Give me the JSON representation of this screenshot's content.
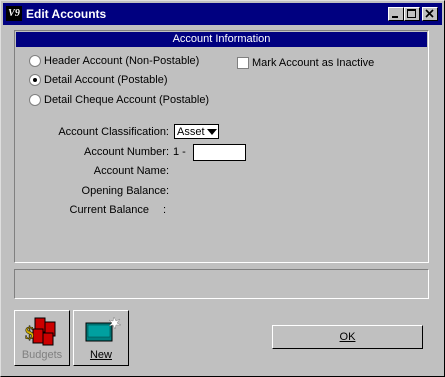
{
  "window": {
    "title": "Edit Accounts",
    "icon_text": "V9"
  },
  "panel": {
    "header": "Account Information",
    "radios": [
      {
        "label": "Header Account (Non-Postable)",
        "selected": false
      },
      {
        "label": "Detail Account (Postable)",
        "selected": true
      },
      {
        "label": "Detail Cheque Account (Postable)",
        "selected": false
      }
    ],
    "inactive_checkbox": {
      "label": "Mark Account as Inactive",
      "checked": false
    },
    "fields": {
      "classification_label": "Account Classification:",
      "classification_value": "Asset",
      "number_label": "Account Number:",
      "number_prefix": "1 -",
      "number_value": "",
      "name_label": "Account Name:",
      "opening_label": "Opening Balance:",
      "current_label": "Current Balance",
      "current_colon": ":"
    }
  },
  "buttons": {
    "budgets": "Budgets",
    "new": "New",
    "ok": "OK"
  }
}
